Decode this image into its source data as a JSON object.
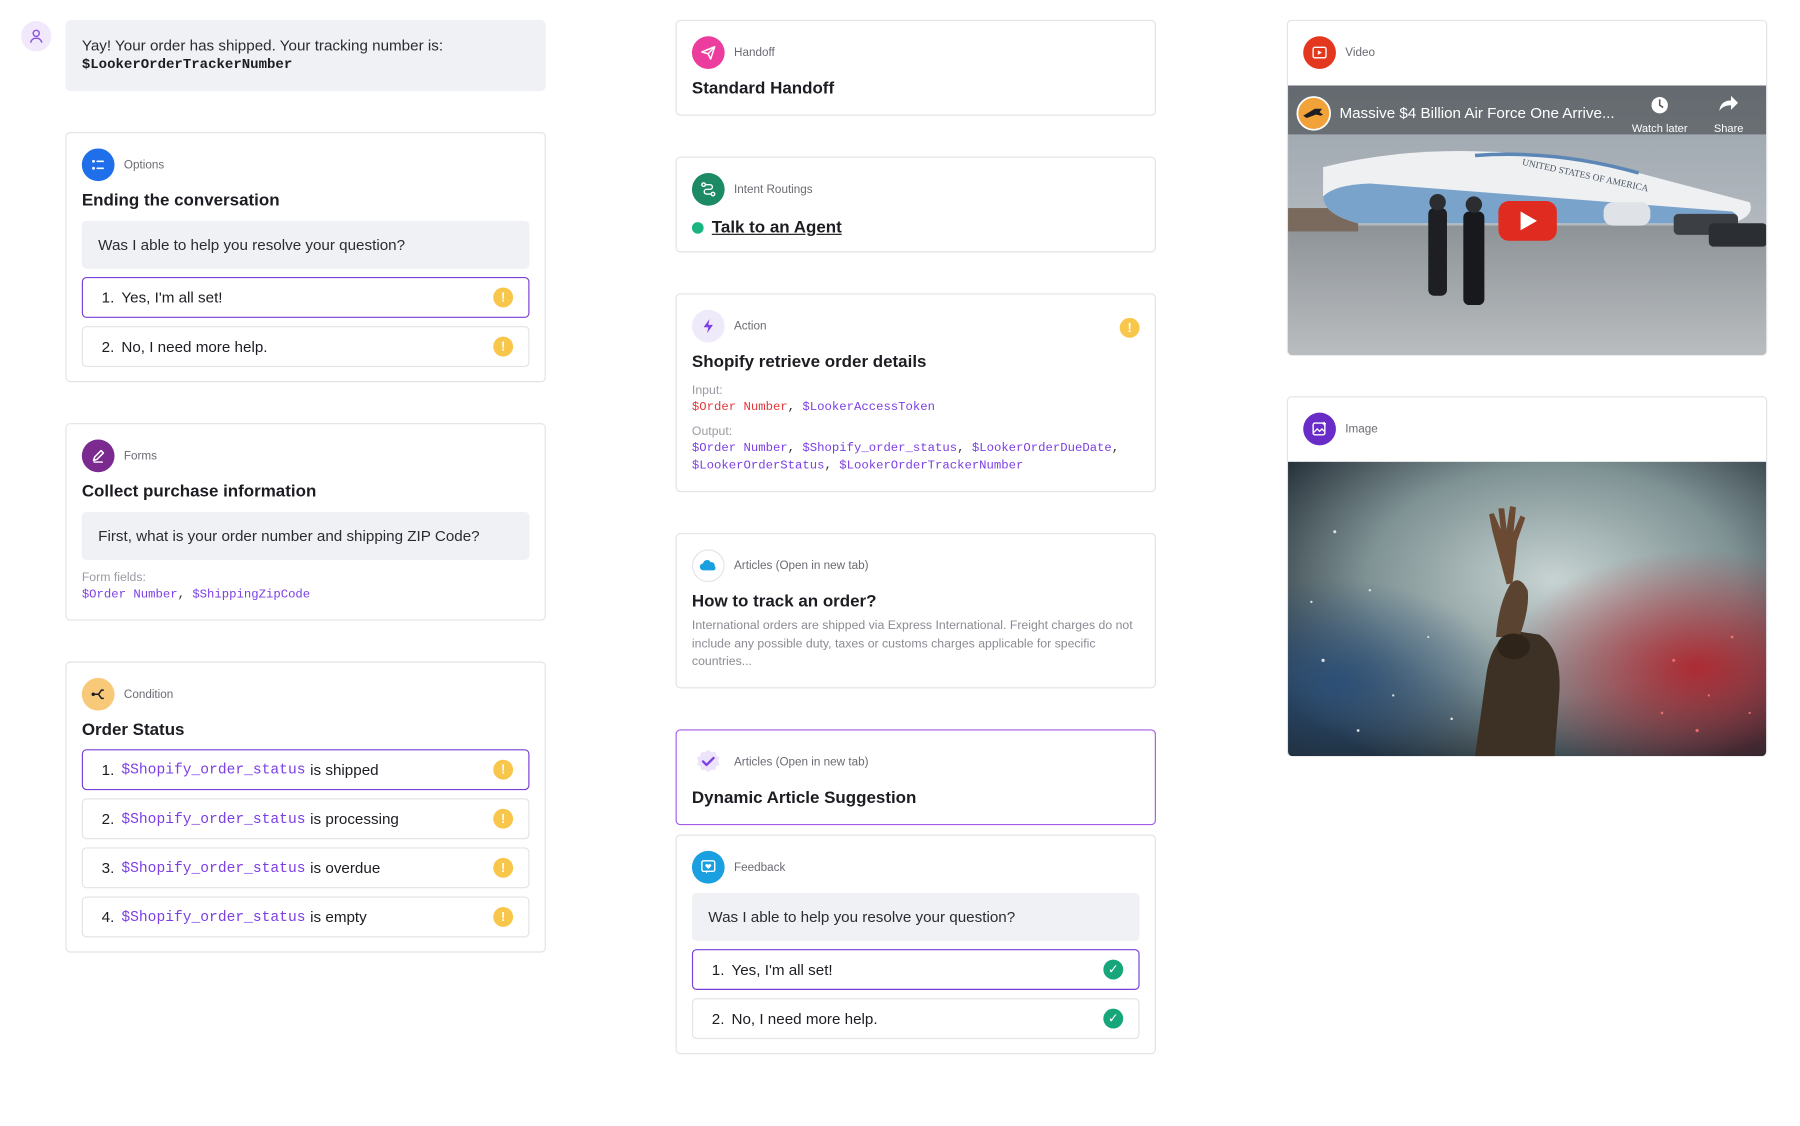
{
  "message": {
    "text": "Yay! Your order has shipped. Your tracking number is:",
    "variable": "$LookerOrderTrackerNumber"
  },
  "options_card": {
    "tag": "Options",
    "title": "Ending the conversation",
    "prompt": "Was I able to help you resolve your question?",
    "items": [
      {
        "num": "1.",
        "label": "Yes, I'm all set!"
      },
      {
        "num": "2.",
        "label": "No, I need more help."
      }
    ]
  },
  "forms_card": {
    "tag": "Forms",
    "title": "Collect purchase information",
    "prompt": "First, what is your order number and shipping ZIP Code?",
    "fields_label": "Form fields:",
    "field_1": "$Order Number",
    "separator": ",",
    "field_2": "$ShippingZipCode"
  },
  "condition_card": {
    "tag": "Condition",
    "title": "Order Status",
    "items": [
      {
        "num": "1.",
        "variable": "$Shopify_order_status",
        "label": "is shipped"
      },
      {
        "num": "2.",
        "variable": "$Shopify_order_status",
        "label": "is processing"
      },
      {
        "num": "3.",
        "variable": "$Shopify_order_status",
        "label": "is overdue"
      },
      {
        "num": "4.",
        "variable": "$Shopify_order_status",
        "label": "is empty"
      }
    ]
  },
  "handoff_card": {
    "tag": "Handoff",
    "title": "Standard Handoff"
  },
  "intent_card": {
    "tag": "Intent Routings",
    "link": "Talk to an Agent"
  },
  "action_card": {
    "tag": "Action",
    "title": "Shopify retrieve order details",
    "input_label": "Input:",
    "input_1": "$Order Number",
    "input_2": "$LookerAccessToken",
    "output_label": "Output:",
    "out_1": "$Order Number",
    "out_2": "$Shopify_order_status",
    "out_3": "$LookerOrderDueDate",
    "out_4": "$LookerOrderStatus",
    "out_5": "$LookerOrderTrackerNumber",
    "sep": ","
  },
  "article_card": {
    "tag": "Articles (Open in new tab)",
    "title": "How to track an order?",
    "body": "International orders are shipped via Express International. Freight charges do not include any possible duty, taxes or customs charges applicable for specific countries..."
  },
  "dynamic_card": {
    "tag": "Articles (Open in new tab)",
    "title": "Dynamic Article Suggestion"
  },
  "feedback_card": {
    "tag": "Feedback",
    "prompt": "Was I able to help you resolve your question?",
    "items": [
      {
        "num": "1.",
        "label": "Yes, I'm all set!"
      },
      {
        "num": "2.",
        "label": "No, I need more help."
      }
    ]
  },
  "video_card": {
    "tag": "Video",
    "video_title": "Massive $4 Billion Air Force One Arrive...",
    "watch_later": "Watch later",
    "share": "Share",
    "plane_text": "UNITED STATES OF AMERICA"
  },
  "image_card": {
    "tag": "Image"
  },
  "colors": {
    "accent": "#7b3fe4",
    "warning": "#f8c64a",
    "success": "#17a67a",
    "variable_red": "#e0373b"
  }
}
